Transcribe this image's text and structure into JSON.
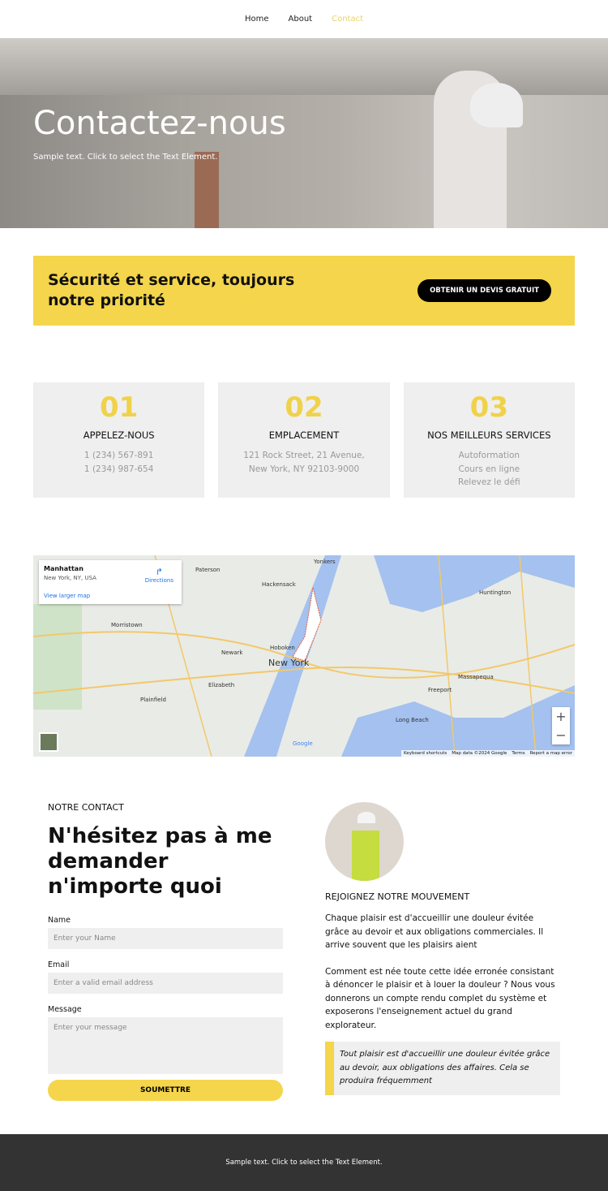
{
  "nav": {
    "items": [
      {
        "label": "Home"
      },
      {
        "label": "About"
      },
      {
        "label": "Contact",
        "active": true
      }
    ]
  },
  "hero": {
    "title": "Contactez-nous",
    "subtitle": "Sample text. Click to select the Text Element."
  },
  "banner": {
    "title": "Sécurité et service, toujours notre priorité",
    "button": "OBTENIR UN DEVIS GRATUIT",
    "color": "#f4d54b"
  },
  "cards": [
    {
      "num": "01",
      "title": "APPELEZ-NOUS",
      "lines": [
        "1 (234) 567-891",
        "1 (234) 987-654"
      ]
    },
    {
      "num": "02",
      "title": "EMPLACEMENT",
      "lines": [
        "121 Rock Street, 21 Avenue,",
        "New York, NY 92103-9000"
      ]
    },
    {
      "num": "03",
      "title": "NOS MEILLEURS SERVICES",
      "lines": [
        "Autoformation",
        "Cours en ligne",
        "Relevez le défi"
      ]
    }
  ],
  "map": {
    "place": "Manhattan",
    "address": "New York, NY, USA",
    "directions": "Directions",
    "larger": "View larger map",
    "city": "New York",
    "labels": [
      "Yonkers",
      "Paterson",
      "Hackensack",
      "Newark",
      "Hoboken",
      "Elizabeth",
      "Plainfield",
      "Morristown",
      "Huntington",
      "Long Beach",
      "Freeport",
      "Massapequa"
    ],
    "attribution": [
      "Keyboard shortcuts",
      "Map data ©2024 Google",
      "Terms",
      "Report a map error"
    ],
    "zoom_in": "+",
    "zoom_out": "−",
    "google": "Google"
  },
  "contact": {
    "eyebrow": "NOTRE CONTACT",
    "title": "N'hésitez pas à me demander n'importe quoi",
    "name_label": "Name",
    "name_placeholder": "Enter your Name",
    "email_label": "Email",
    "email_placeholder": "Enter a valid email address",
    "message_label": "Message",
    "message_placeholder": "Enter your message",
    "submit": "SOUMETTRE"
  },
  "join": {
    "title": "REJOIGNEZ NOTRE MOUVEMENT",
    "p1": "Chaque plaisir est d'accueillir une douleur évitée grâce au devoir et aux obligations commerciales. Il arrive souvent que les plaisirs aient",
    "p2": "Comment est née toute cette idée erronée consistant à dénoncer le plaisir et à louer la douleur ? Nous vous donnerons un compte rendu complet du système et exposerons l'enseignement actuel du grand explorateur.",
    "quote": "Tout plaisir est d'accueillir une douleur évitée grâce au devoir, aux obligations des affaires. Cela se produira fréquemment"
  },
  "footer": {
    "text": "Sample text. Click to select the Text Element."
  }
}
